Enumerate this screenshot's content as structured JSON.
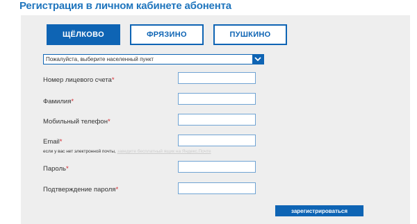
{
  "page": {
    "title": "Регистрация в личном кабинете абонента"
  },
  "tabs": [
    {
      "label": "ЩЁЛКОВО",
      "active": true
    },
    {
      "label": "ФРЯЗИНО",
      "active": false
    },
    {
      "label": "ПУШКИНО",
      "active": false
    }
  ],
  "locality_select": {
    "value": "Пожалуйста, выберите населенный пункт"
  },
  "fields": {
    "account": {
      "label": "Номер лицевого счета",
      "required_mark": "*",
      "value": ""
    },
    "surname": {
      "label": "Фамилия",
      "required_mark": "*",
      "value": ""
    },
    "phone": {
      "label": "Мобильный телефон",
      "required_mark": "*",
      "value": ""
    },
    "email": {
      "label": "Email",
      "required_mark": "*",
      "value": ""
    },
    "password": {
      "label": "Пароль",
      "required_mark": "*",
      "value": ""
    },
    "password_confirm": {
      "label": "Подтверждение пароля",
      "required_mark": "*",
      "value": ""
    }
  },
  "email_note": {
    "text": "если у вас нет электронной почты,",
    "link": "заведите бесплатный ящик на Яндекс.Почте"
  },
  "submit": {
    "label": "зарегистрироваться"
  },
  "colors": {
    "accent": "#0e64b4",
    "title": "#1f75bd",
    "required": "#d2232a",
    "panel_bg": "#eeeeee"
  }
}
